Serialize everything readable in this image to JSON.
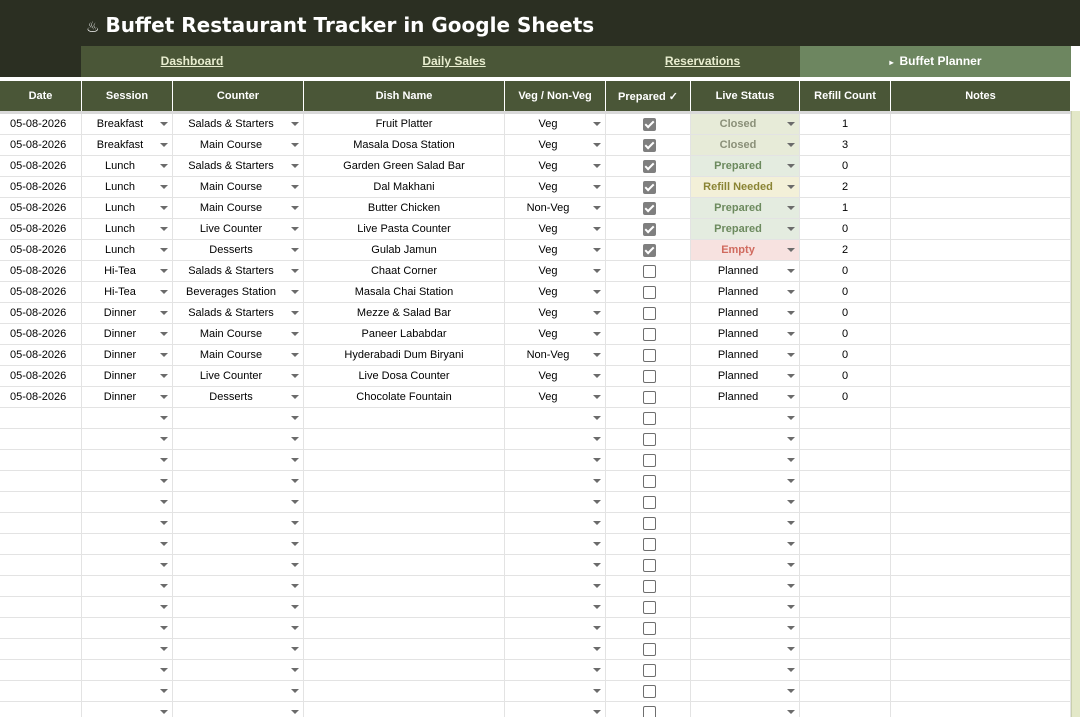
{
  "title": {
    "icon": "buffet-icon",
    "text": "Buffet Restaurant Tracker in Google Sheets"
  },
  "nav": {
    "tabs": [
      {
        "label": "Dashboard",
        "active": false
      },
      {
        "label": "Daily Sales",
        "active": false
      },
      {
        "label": "Reservations",
        "active": false
      },
      {
        "label": "Buffet Planner",
        "active": true
      }
    ],
    "active_marker": "▸"
  },
  "table": {
    "headers": {
      "date": "Date",
      "session": "Session",
      "counter": "Counter",
      "dish": "Dish Name",
      "veg": "Veg / Non-Veg",
      "prepared": "Prepared ✓",
      "status": "Live Status",
      "refill": "Refill Count",
      "notes": "Notes"
    },
    "rows": [
      {
        "date": "05-08-2026",
        "session": "Breakfast",
        "counter": "Salads & Starters",
        "dish": "Fruit Platter",
        "veg": "Veg",
        "prepared": true,
        "status": "Closed",
        "refill": "1",
        "notes": ""
      },
      {
        "date": "05-08-2026",
        "session": "Breakfast",
        "counter": "Main Course",
        "dish": "Masala Dosa Station",
        "veg": "Veg",
        "prepared": true,
        "status": "Closed",
        "refill": "3",
        "notes": ""
      },
      {
        "date": "05-08-2026",
        "session": "Lunch",
        "counter": "Salads & Starters",
        "dish": "Garden Green Salad Bar",
        "veg": "Veg",
        "prepared": true,
        "status": "Prepared",
        "refill": "0",
        "notes": ""
      },
      {
        "date": "05-08-2026",
        "session": "Lunch",
        "counter": "Main Course",
        "dish": "Dal Makhani",
        "veg": "Veg",
        "prepared": true,
        "status": "Refill Needed",
        "refill": "2",
        "notes": ""
      },
      {
        "date": "05-08-2026",
        "session": "Lunch",
        "counter": "Main Course",
        "dish": "Butter Chicken",
        "veg": "Non-Veg",
        "prepared": true,
        "status": "Prepared",
        "refill": "1",
        "notes": ""
      },
      {
        "date": "05-08-2026",
        "session": "Lunch",
        "counter": "Live Counter",
        "dish": "Live Pasta Counter",
        "veg": "Veg",
        "prepared": true,
        "status": "Prepared",
        "refill": "0",
        "notes": ""
      },
      {
        "date": "05-08-2026",
        "session": "Lunch",
        "counter": "Desserts",
        "dish": "Gulab Jamun",
        "veg": "Veg",
        "prepared": true,
        "status": "Empty",
        "refill": "2",
        "notes": ""
      },
      {
        "date": "05-08-2026",
        "session": "Hi-Tea",
        "counter": "Salads & Starters",
        "dish": "Chaat Corner",
        "veg": "Veg",
        "prepared": false,
        "status": "Planned",
        "refill": "0",
        "notes": ""
      },
      {
        "date": "05-08-2026",
        "session": "Hi-Tea",
        "counter": "Beverages Station",
        "dish": "Masala Chai Station",
        "veg": "Veg",
        "prepared": false,
        "status": "Planned",
        "refill": "0",
        "notes": ""
      },
      {
        "date": "05-08-2026",
        "session": "Dinner",
        "counter": "Salads & Starters",
        "dish": "Mezze & Salad Bar",
        "veg": "Veg",
        "prepared": false,
        "status": "Planned",
        "refill": "0",
        "notes": ""
      },
      {
        "date": "05-08-2026",
        "session": "Dinner",
        "counter": "Main Course",
        "dish": "Paneer Lababdar",
        "veg": "Veg",
        "prepared": false,
        "status": "Planned",
        "refill": "0",
        "notes": ""
      },
      {
        "date": "05-08-2026",
        "session": "Dinner",
        "counter": "Main Course",
        "dish": "Hyderabadi Dum Biryani",
        "veg": "Non-Veg",
        "prepared": false,
        "status": "Planned",
        "refill": "0",
        "notes": ""
      },
      {
        "date": "05-08-2026",
        "session": "Dinner",
        "counter": "Live Counter",
        "dish": "Live Dosa Counter",
        "veg": "Veg",
        "prepared": false,
        "status": "Planned",
        "refill": "0",
        "notes": ""
      },
      {
        "date": "05-08-2026",
        "session": "Dinner",
        "counter": "Desserts",
        "dish": "Chocolate Fountain",
        "veg": "Veg",
        "prepared": false,
        "status": "Planned",
        "refill": "0",
        "notes": ""
      }
    ],
    "empty_rows": 15
  },
  "colors": {
    "title_bg": "#2b2f22",
    "header_bg": "#4a5637",
    "active_tab_bg": "#6d8660",
    "closed": "#8a8f78",
    "prepared": "#6c8a5e",
    "refill_needed": "#8a8434",
    "empty": "#d06a5e"
  }
}
